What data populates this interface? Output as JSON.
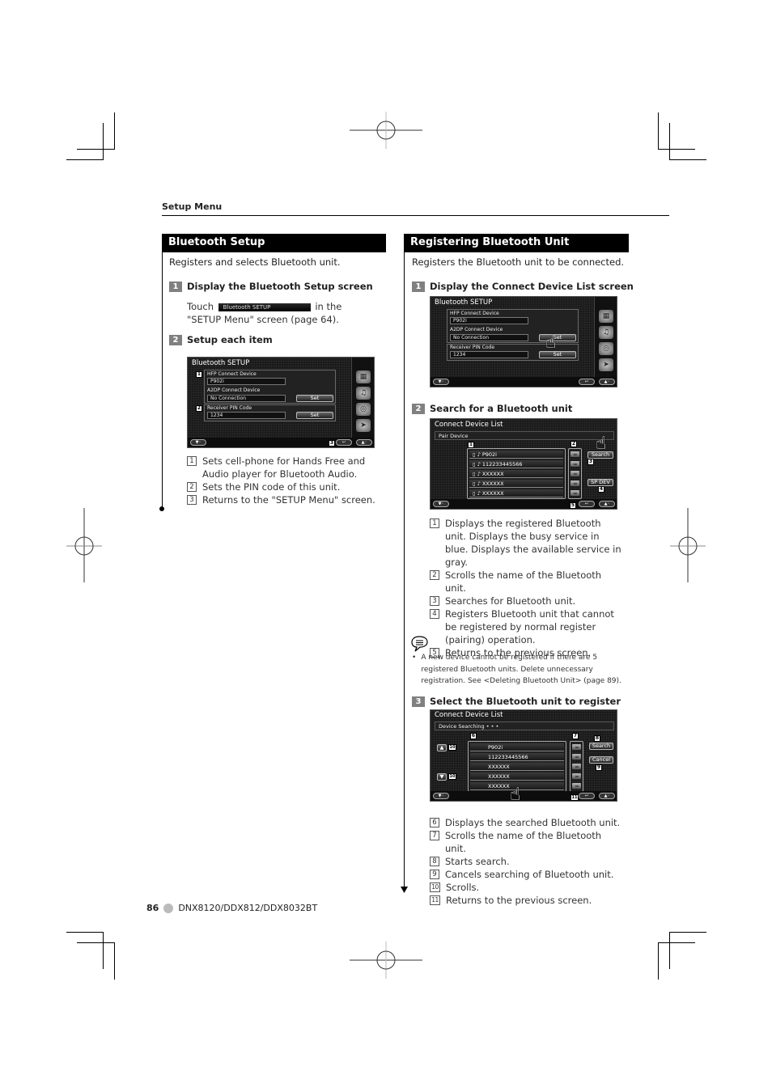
{
  "running_head": "Setup Menu",
  "left_section": {
    "title": "Bluetooth Setup",
    "intro": "Registers and selects Bluetooth unit.",
    "step1": {
      "number": "1",
      "title": "Display the Bluetooth Setup screen",
      "text_before": "Touch",
      "button_label": "Bluetooth SETUP",
      "text_after": "in the \"SETUP Menu\" screen (page 64)."
    },
    "step2": {
      "number": "2",
      "title": "Setup each item"
    },
    "screen": {
      "title": "Bluetooth SETUP",
      "hfp_label": "HFP Connect Device",
      "hfp_value": "P902i",
      "a2dp_label": "A2DP Connect Device",
      "a2dp_value": "No Connection",
      "pin_label": "Receiver PIN Code",
      "pin_value": "1234",
      "set_label": "Set",
      "markers": [
        "1",
        "2",
        "3"
      ],
      "side_icons": [
        "display-icon",
        "av-icon",
        "speaker-icon",
        "navigation-icon"
      ]
    },
    "legend": [
      {
        "num": "1",
        "text": "Sets cell-phone for Hands Free and Audio player for Bluetooth Audio."
      },
      {
        "num": "2",
        "text": "Sets the PIN code of this unit."
      },
      {
        "num": "3",
        "text": "Returns to the \"SETUP Menu\" screen."
      }
    ]
  },
  "right_section": {
    "title": "Registering Bluetooth Unit",
    "intro": "Registers the Bluetooth unit to be connected.",
    "step1": {
      "number": "1",
      "title": "Display the Connect Device List screen"
    },
    "screen1": {
      "title": "Bluetooth SETUP",
      "hfp_label": "HFP Connect Device",
      "hfp_value": "P902i",
      "a2dp_label": "A2DP Connect Device",
      "a2dp_value": "No Connection",
      "pin_label": "Receiver PIN Code",
      "pin_value": "1234",
      "set_label": "Set"
    },
    "step2": {
      "number": "2",
      "title": "Search for a Bluetooth unit"
    },
    "screen2": {
      "title": "Connect Device List",
      "subtitle": "Pair Device",
      "devices": [
        "P902i",
        "112233445566",
        "XXXXXX",
        "XXXXXX",
        "XXXXXX"
      ],
      "search_label": "Search",
      "spdev_label": "SP DEV",
      "markers": [
        "1",
        "2",
        "3",
        "4",
        "5"
      ]
    },
    "legend1": [
      {
        "num": "1",
        "text": "Displays the registered Bluetooth unit. Displays the busy service in blue. Displays the available service in gray."
      },
      {
        "num": "2",
        "text": "Scrolls the name of the Bluetooth unit."
      },
      {
        "num": "3",
        "text": "Searches for Bluetooth unit."
      },
      {
        "num": "4",
        "text": "Registers Bluetooth unit that cannot be registered by normal register (pairing) operation."
      },
      {
        "num": "5",
        "text": "Returns to the previous screen."
      }
    ],
    "note": "A new device cannot be registered if there are 5 registered Bluetooth units. Delete unnecessary registration. See <Deleting Bluetooth Unit> (page 89).",
    "step3": {
      "number": "3",
      "title": "Select the Bluetooth unit to register"
    },
    "screen3": {
      "title": "Connect Device List",
      "subtitle": "Device Searching • • •",
      "devices": [
        "P902i",
        "112233445566",
        "XXXXXX",
        "XXXXXX",
        "XXXXXX"
      ],
      "search_label": "Search",
      "cancel_label": "Cancel",
      "markers": [
        "6",
        "7",
        "8",
        "9",
        "10",
        "10",
        "11"
      ]
    },
    "legend2": [
      {
        "num": "6",
        "text": "Displays the searched Bluetooth unit."
      },
      {
        "num": "7",
        "text": "Scrolls the name of the Bluetooth unit."
      },
      {
        "num": "8",
        "text": "Starts search."
      },
      {
        "num": "9",
        "text": "Cancels searching of Bluetooth unit."
      },
      {
        "num": "10",
        "text": "Scrolls."
      },
      {
        "num": "11",
        "text": "Returns to the previous screen."
      }
    ]
  },
  "footer": {
    "page_number": "86",
    "model": "DNX8120/DDX812/DDX8032BT"
  }
}
